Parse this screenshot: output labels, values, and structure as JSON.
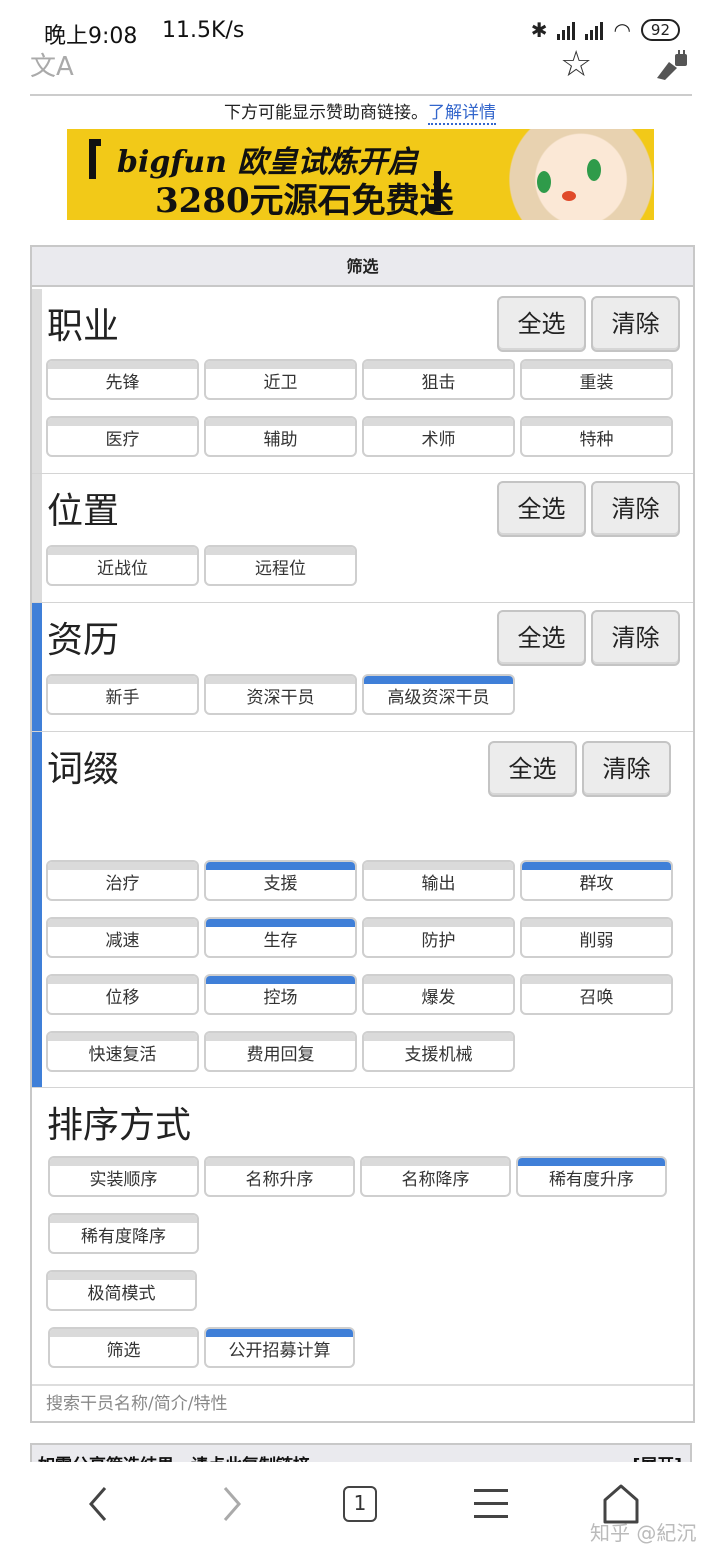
{
  "status_bar": {
    "time": "晚上9:08",
    "speed": "11.5K/s",
    "battery": "92",
    "icons": [
      "bluetooth-icon",
      "hd-signal-icon",
      "signal-icon",
      "wifi-icon",
      "battery-icon"
    ]
  },
  "browser_toolbar": {
    "translate_icon": "文A",
    "star_icon": "☆"
  },
  "sponsor": {
    "text": "下方可能显示赞助商链接。",
    "link": "了解详情"
  },
  "banner": {
    "line1": "bigfun 欧皇试炼开启",
    "line2": "3280元源石免费送"
  },
  "filter_panel": {
    "title": "筛选",
    "select_all": "全选",
    "clear": "清除",
    "sections": [
      {
        "title": "职业",
        "active": false,
        "chips": [
          {
            "label": "先锋",
            "selected": false
          },
          {
            "label": "近卫",
            "selected": false
          },
          {
            "label": "狙击",
            "selected": false
          },
          {
            "label": "重装",
            "selected": false
          },
          {
            "label": "医疗",
            "selected": false
          },
          {
            "label": "辅助",
            "selected": false
          },
          {
            "label": "术师",
            "selected": false
          },
          {
            "label": "特种",
            "selected": false
          }
        ]
      },
      {
        "title": "位置",
        "active": false,
        "chips": [
          {
            "label": "近战位",
            "selected": false
          },
          {
            "label": "远程位",
            "selected": false
          }
        ]
      },
      {
        "title": "资历",
        "active": true,
        "chips": [
          {
            "label": "新手",
            "selected": false
          },
          {
            "label": "资深干员",
            "selected": false
          },
          {
            "label": "高级资深干员",
            "selected": true
          }
        ]
      },
      {
        "title": "词缀",
        "active": true,
        "chips": [
          {
            "label": "治疗",
            "selected": false
          },
          {
            "label": "支援",
            "selected": true
          },
          {
            "label": "输出",
            "selected": false
          },
          {
            "label": "群攻",
            "selected": true
          },
          {
            "label": "减速",
            "selected": false
          },
          {
            "label": "生存",
            "selected": true
          },
          {
            "label": "防护",
            "selected": false
          },
          {
            "label": "削弱",
            "selected": false
          },
          {
            "label": "位移",
            "selected": false
          },
          {
            "label": "控场",
            "selected": true
          },
          {
            "label": "爆发",
            "selected": false
          },
          {
            "label": "召唤",
            "selected": false
          },
          {
            "label": "快速复活",
            "selected": false
          },
          {
            "label": "费用回复",
            "selected": false
          },
          {
            "label": "支援机械",
            "selected": false
          }
        ]
      }
    ],
    "sort": {
      "title": "排序方式",
      "options": [
        {
          "label": "实装顺序",
          "selected": false
        },
        {
          "label": "名称升序",
          "selected": false
        },
        {
          "label": "名称降序",
          "selected": false
        },
        {
          "label": "稀有度升序",
          "selected": true
        },
        {
          "label": "稀有度降序",
          "selected": false
        }
      ],
      "simple_mode": {
        "label": "极简模式",
        "selected": false
      },
      "modes": [
        {
          "label": "筛选",
          "selected": false
        },
        {
          "label": "公开招募计算",
          "selected": true
        }
      ]
    },
    "search_placeholder": "搜索干员名称/简介/特性"
  },
  "share_bar": {
    "text": "如需分享筛选结果，请点此复制链接",
    "expand": "[展开]"
  },
  "nav_bar": {
    "tab_count": "1",
    "watermark": "知乎 @紀沉"
  },
  "colors": {
    "accent": "#3f7fd8",
    "chip_top_off": "#dadada",
    "panel_head": "#eaeaee",
    "banner": "#f2c918"
  }
}
